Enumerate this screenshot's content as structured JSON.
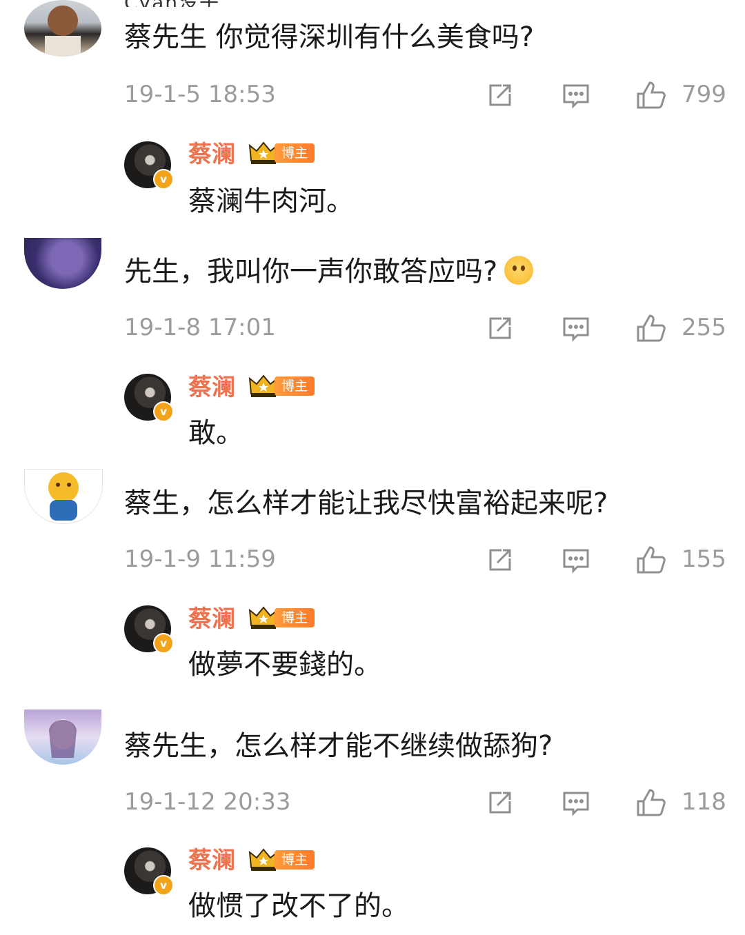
{
  "colors": {
    "accent": "#eb7350",
    "meta": "#9b9b9b",
    "text": "#1a1a1a",
    "tag": "#ff8a30"
  },
  "comments": [
    {
      "username_partial": "Cyan没子",
      "text": "蔡先生 你觉得深圳有什么美食吗?",
      "emoji": "",
      "timestamp": "19-1-5 18:53",
      "likes": "799",
      "reply": {
        "name": "蔡澜",
        "badge": "博主",
        "verified": "v",
        "text": "蔡澜牛肉河。"
      }
    },
    {
      "username_partial": "",
      "text": "先生，我叫你一声你敢答应吗?",
      "emoji": "smiling-blush-emoji",
      "timestamp": "19-1-8 17:01",
      "likes": "255",
      "reply": {
        "name": "蔡澜",
        "badge": "博主",
        "verified": "v",
        "text": "敢。"
      }
    },
    {
      "username_partial": "",
      "text": "蔡生，怎么样才能让我尽快富裕起来呢?",
      "emoji": "",
      "timestamp": "19-1-9 11:59",
      "likes": "155",
      "reply": {
        "name": "蔡澜",
        "badge": "博主",
        "verified": "v",
        "text": "做夢不要錢的。"
      }
    },
    {
      "username_partial": "",
      "text": "蔡先生，怎么样才能不继续做舔狗?",
      "emoji": "",
      "timestamp": "19-1-12 20:33",
      "likes": "118",
      "reply": {
        "name": "蔡澜",
        "badge": "博主",
        "verified": "v",
        "text": "做惯了改不了的。"
      }
    }
  ],
  "icons": {
    "share": "share-icon",
    "comment": "comment-icon",
    "like": "like-icon",
    "crown": "crown-icon"
  }
}
